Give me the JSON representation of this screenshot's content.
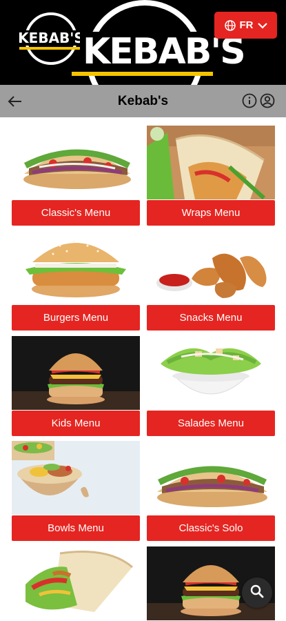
{
  "banner": {
    "logo_small_text": "KEBAB'S",
    "logo_big_text": "KEBAB'S"
  },
  "language": {
    "label": "FR"
  },
  "navbar": {
    "title": "Kebab's"
  },
  "menu": {
    "items": [
      {
        "label": "Classic's Menu"
      },
      {
        "label": "Wraps Menu"
      },
      {
        "label": "Burgers Menu"
      },
      {
        "label": "Snacks Menu"
      },
      {
        "label": "Kids Menu"
      },
      {
        "label": "Salades Menu"
      },
      {
        "label": "Bowls Menu"
      },
      {
        "label": "Classic's Solo"
      }
    ]
  },
  "colors": {
    "accent": "#e52521",
    "header": "#000000",
    "navbar": "#9e9e9e",
    "logo_bar": "#f5c400"
  }
}
